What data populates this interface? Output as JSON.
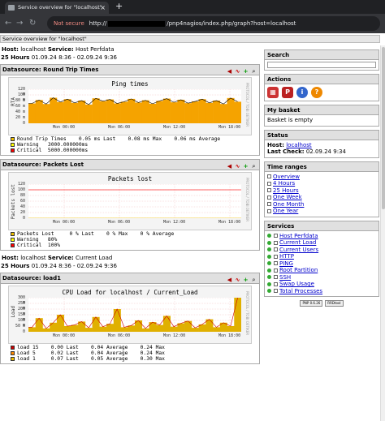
{
  "browser": {
    "tab_title": "Service overview for \"localhost\"",
    "url_scheme": "http://",
    "url_path": "/pnp4nagios/index.php/graph?host=localhost",
    "not_secure": "Not secure"
  },
  "page_header": "Service overview for \"localhost\"",
  "sections": [
    {
      "host_label": "Host:",
      "host": "localhost",
      "service_label": "Service:",
      "service": "Host Perfdata",
      "range_label": "25 Hours",
      "range": "01.09.24 8:36 - 02.09.24 9:36"
    },
    {
      "host_label": "Host:",
      "host": "localhost",
      "service_label": "Service:",
      "service": "Current Load",
      "range_label": "25 Hours",
      "range": "01.09.24 8:36 - 02.09.24 9:36"
    }
  ],
  "datasources": [
    {
      "label": "Datasource: Round Trip Times",
      "graph_title": "Ping times",
      "y_axis": "RTA",
      "y_ticks": [
        "120 m",
        "100 m",
        "80 m",
        "60 m",
        "40 m",
        "20 m",
        "0"
      ],
      "x_ticks": [
        "Mon 00:00",
        "Mon 06:00",
        "Mon 12:00",
        "Mon 18:00"
      ],
      "side_text": "PROTOCOL / TOBI OETIKER",
      "legend": [
        {
          "color": "#f0c000",
          "text": "Round Trip Times    0.05 ms Last    0.08 ms Max    0.06 ms Average"
        },
        {
          "color": "#ffff00",
          "text": "Warning   3000.000000ms"
        },
        {
          "color": "#ff0000",
          "text": "Critical  5000.000000ms"
        }
      ]
    },
    {
      "label": "Datasource: Packets Lost",
      "graph_title": "Packets lost",
      "y_axis": "Packets lost",
      "y_ticks": [
        "120",
        "100",
        "80",
        "60",
        "40",
        "20",
        "0"
      ],
      "x_ticks": [
        "Mon 00:00",
        "Mon 06:00",
        "Mon 12:00",
        "Mon 18:00"
      ],
      "side_text": "PROTOCOL / TOBI OETIKER",
      "legend": [
        {
          "color": "#f0c000",
          "text": "Packets Lost     0 % Last    0 % Max    0 % Average"
        },
        {
          "color": "#ffff00",
          "text": "Warning   80%"
        },
        {
          "color": "#ff0000",
          "text": "Critical  100%"
        }
      ]
    },
    {
      "label": "Datasource: load1",
      "graph_title": "CPU Load for localhost / Current_Load",
      "y_axis": "Load",
      "y_ticks": [
        "300 m",
        "250 m",
        "200 m",
        "150 m",
        "100 m",
        "50 m",
        "0"
      ],
      "x_ticks": [
        "Mon 00:00",
        "Mon 06:00",
        "Mon 12:00",
        "Mon 18:00"
      ],
      "side_text": "PROTOCOL / TOBI OETIKER",
      "legend": [
        {
          "color": "#cc0000",
          "text": "load 15    0.00 Last    0.04 Average    0.24 Max"
        },
        {
          "color": "#ff8800",
          "text": "Load 5     0.02 Last    0.04 Average    0.24 Max"
        },
        {
          "color": "#f0c000",
          "text": "load 1     0.07 Last    0.05 Average    0.30 Max"
        }
      ]
    }
  ],
  "sidebar": {
    "search": {
      "title": "Search"
    },
    "actions": {
      "title": "Actions"
    },
    "basket": {
      "title": "My basket",
      "text": "Basket is empty"
    },
    "status": {
      "title": "Status",
      "host_label": "Host:",
      "host": "localhost",
      "check_label": "Last Check:",
      "check": "02.09.24 9:34"
    },
    "time_ranges": {
      "title": "Time ranges",
      "items": [
        "Overview",
        "4 Hours",
        "25 Hours",
        "One Week",
        "One Month",
        "One Year"
      ]
    },
    "services": {
      "title": "Services",
      "items": [
        "Host Perfdata",
        "Current Load",
        "Current Users",
        "HTTP",
        "PING",
        "Root Partition",
        "SSH",
        "Swap Usage",
        "Total Processes"
      ]
    },
    "footer": [
      "PNP 0.6.26",
      "RRDtool"
    ]
  },
  "chart_data": [
    {
      "type": "area",
      "title": "Ping times",
      "ylabel": "RTA",
      "ylim": [
        0,
        120
      ],
      "x": [
        "Mon 00:00",
        "Mon 06:00",
        "Mon 12:00",
        "Mon 18:00"
      ],
      "series": [
        {
          "name": "Round Trip Times",
          "values": [
            70,
            82,
            68,
            90,
            75,
            85,
            72,
            80,
            66,
            88,
            78,
            84,
            70,
            76,
            86,
            73,
            81,
            69,
            79,
            87,
            74,
            83,
            71,
            77,
            85,
            72,
            80,
            68,
            89,
            76
          ]
        }
      ]
    },
    {
      "type": "line",
      "title": "Packets lost",
      "ylabel": "Packets lost",
      "ylim": [
        0,
        120
      ],
      "x": [
        "Mon 00:00",
        "Mon 06:00",
        "Mon 12:00",
        "Mon 18:00"
      ],
      "series": [
        {
          "name": "Packets Lost",
          "values": [
            0,
            0,
            0,
            0
          ]
        },
        {
          "name": "Critical",
          "values": [
            100,
            100,
            100,
            100
          ]
        }
      ]
    },
    {
      "type": "area",
      "title": "CPU Load for localhost / Current_Load",
      "ylabel": "Load",
      "ylim": [
        0,
        300
      ],
      "x": [
        "Mon 00:00",
        "Mon 06:00",
        "Mon 12:00",
        "Mon 18:00"
      ],
      "series": [
        {
          "name": "load 1",
          "values": [
            40,
            120,
            30,
            80,
            150,
            50,
            60,
            90,
            35,
            130,
            45,
            70,
            200,
            40,
            55,
            100,
            30,
            85,
            60,
            140,
            45,
            75,
            95,
            35,
            65,
            110,
            40,
            80,
            50,
            300
          ]
        }
      ]
    }
  ]
}
